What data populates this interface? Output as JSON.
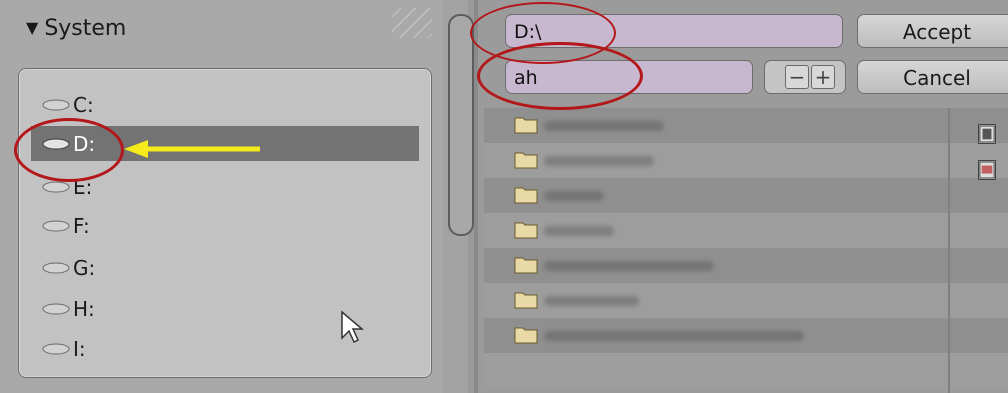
{
  "sidebar": {
    "header": "System",
    "drives": [
      {
        "label": "C:",
        "selected": false
      },
      {
        "label": "D:",
        "selected": true
      },
      {
        "label": "E:",
        "selected": false
      },
      {
        "label": "F:",
        "selected": false
      },
      {
        "label": "G:",
        "selected": false
      },
      {
        "label": "H:",
        "selected": false
      },
      {
        "label": "I:",
        "selected": false
      }
    ]
  },
  "toolbar": {
    "path_value": "D:\\",
    "filter_value": "ah",
    "accept_label": "Accept",
    "cancel_label": "Cancel",
    "minus_label": "−",
    "plus_label": "+"
  },
  "file_list": {
    "row_count": 7,
    "item_icon": "folder-icon"
  },
  "colors": {
    "field_bg": "#c8b8cf",
    "selected_row": "#737373",
    "annotation_red": "#b4171a",
    "annotation_arrow": "#f5ea1a"
  }
}
